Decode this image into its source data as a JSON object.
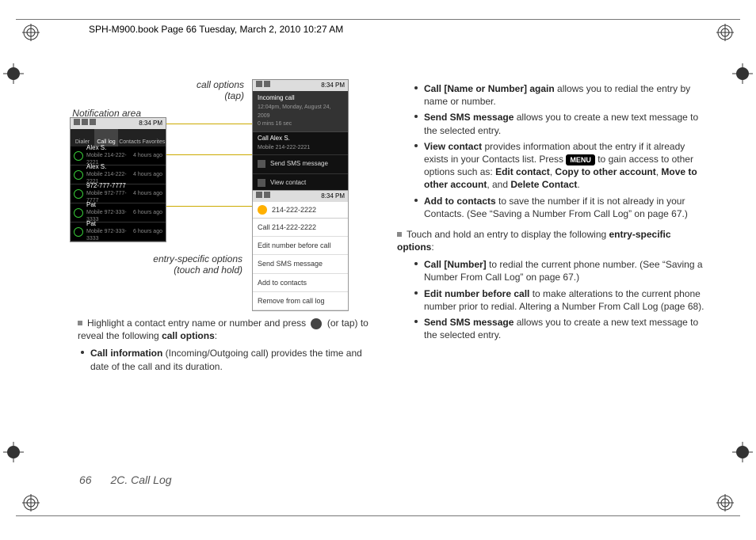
{
  "header": {
    "book_title": "SPH-M900.book  Page 66  Tuesday, March 2, 2010  10:27 AM"
  },
  "footer": {
    "page_number": "66",
    "section": "2C. Call Log"
  },
  "labels": {
    "call_options_1": "call options",
    "call_options_2": "(tap)",
    "notification_area": "Notification area",
    "entry_specific_1": "entry-specific options",
    "entry_specific_2": "(touch and hold)"
  },
  "phone_main": {
    "time": "8:34 PM",
    "tabs": [
      "Dialer",
      "Call log",
      "Contacts",
      "Favorites"
    ],
    "rows": [
      {
        "name": "Alex S.",
        "sub": "Mobile 214-222-2221",
        "time": "4 hours ago"
      },
      {
        "name": "Alex S.",
        "sub": "Mobile 214-222-2221",
        "time": "4 hours ago"
      },
      {
        "name": "972-777-7777",
        "sub": "Mobile 972-777-7777",
        "time": "4 hours ago"
      },
      {
        "name": "Pat",
        "sub": "Mobile 972-333-3333",
        "time": "6 hours ago"
      },
      {
        "name": "Pat",
        "sub": "Mobile 972-333-3333",
        "time": "6 hours ago"
      }
    ]
  },
  "phone_incoming": {
    "time": "8:34 PM",
    "title": "Incoming call",
    "subtitle": "12:04pm, Monday, August 24, 2009",
    "duration": "0 mins 16 sec",
    "contact_name": "Call Alex S.",
    "contact_number": "Mobile 214-222-2221",
    "items": [
      "Send SMS message",
      "View contact"
    ]
  },
  "phone_ctx": {
    "time": "8:34 PM",
    "header_number": "214-222-2222",
    "items": [
      "Call 214-222-2222",
      "Edit number before call",
      "Send SMS message",
      "Add to contacts",
      "Remove from call log"
    ]
  },
  "left_col": {
    "intro_1": "Highlight a contact entry name or number and press ",
    "intro_2": " (or tap) to reveal the following ",
    "intro_bold": "call options",
    "intro_3": ":",
    "bullet1_b": "Call information",
    "bullet1_t": " (Incoming/Outgoing call) provides the time and date of the call and its duration."
  },
  "right_col": {
    "b1_b": "Call [Name or Number] again",
    "b1_t": " allows you to redial the entry by name or number.",
    "b2_b": "Send SMS message",
    "b2_t": " allows you to create a new text message to the selected entry.",
    "b3_b": "View contact",
    "b3_t1": " provides information about the entry if it already exists in your Contacts list. Press ",
    "b3_menu": "MENU",
    "b3_t2": " to gain access to other options such as: ",
    "b3_o1": "Edit contact",
    "b3_o2": "Copy to other account",
    "b3_o3": "Move to other account",
    "b3_and": ", and ",
    "b3_o4": "Delete Contact",
    "b3_period": ".",
    "b4_b": "Add to contacts",
    "b4_t": " to save the number if it is not already in your Contacts. (See “Saving a Number From Call Log” on page 67.)",
    "sq_text1": "Touch and hold an entry to display the following ",
    "sq_bold": "entry-specific options",
    "sq_text2": ":",
    "s1_b": "Call [Number]",
    "s1_t": " to redial the current phone number. (See “Saving a Number From Call Log” on page 67.)",
    "s2_b": "Edit number before call",
    "s2_t": " to make alterations to the current phone number prior to redial. Altering a Number From Call Log (page 68).",
    "s3_b": "Send SMS message",
    "s3_t": " allows you to create a new text message to the selected entry."
  }
}
